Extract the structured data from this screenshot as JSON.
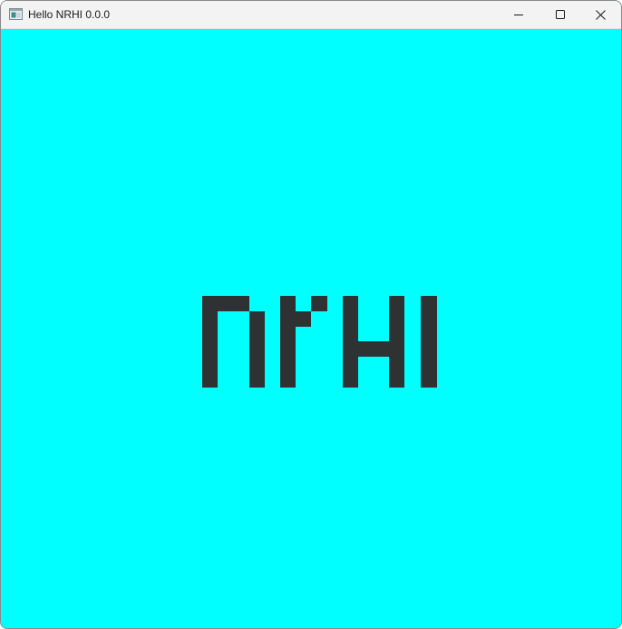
{
  "window": {
    "title": "Hello NRHI 0.0.0",
    "app_icon": "app-window-icon",
    "controls": {
      "minimize": "minimize-icon",
      "maximize": "maximize-icon",
      "close": "close-icon"
    }
  },
  "canvas": {
    "background_color": "#00ffff",
    "logo_color": "#2e3233",
    "logo_text": "NRHI"
  }
}
